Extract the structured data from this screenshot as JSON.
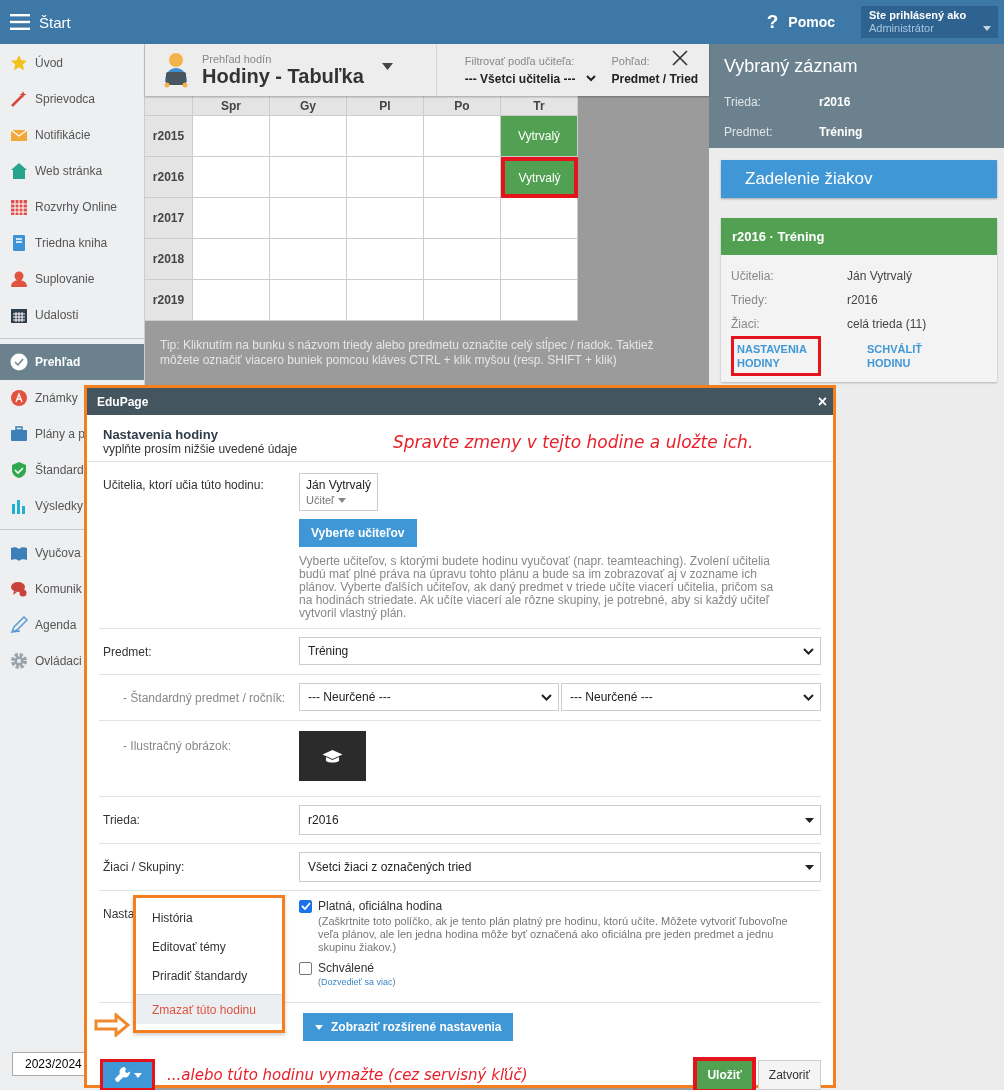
{
  "topbar": {
    "title": "Štart",
    "help_icon": "?",
    "help": "Pomoc",
    "user_label": "Ste prihlásený ako",
    "user_name": "Administrátor"
  },
  "sidebar": {
    "groups": [
      {
        "items": [
          {
            "label": "Úvod",
            "selected": false
          },
          {
            "label": "Sprievodca",
            "selected": false
          },
          {
            "label": "Notifikácie",
            "selected": false
          },
          {
            "label": "Web stránka",
            "selected": false
          },
          {
            "label": "Rozvrhy Online",
            "selected": false
          },
          {
            "label": "Triedna kniha",
            "selected": false
          },
          {
            "label": "Suplovanie",
            "selected": false
          },
          {
            "label": "Udalosti",
            "selected": false
          }
        ]
      },
      {
        "items": [
          {
            "label": "Prehľad",
            "selected": true
          },
          {
            "label": "Známky",
            "selected": false
          },
          {
            "label": "Plány a p",
            "selected": false
          },
          {
            "label": "Štandard",
            "selected": false
          },
          {
            "label": "Výsledky",
            "selected": false
          }
        ]
      },
      {
        "items": [
          {
            "label": "Vyučova",
            "selected": false
          },
          {
            "label": "Komunik",
            "selected": false
          },
          {
            "label": "Agenda",
            "selected": false
          },
          {
            "label": "Ovládaci",
            "selected": false
          }
        ]
      }
    ],
    "year": "2023/2024"
  },
  "header": {
    "subtitle": "Prehľad hodín",
    "title": "Hodiny - Tabuľka",
    "filter_label": "Filtrovať podľa učiteľa:",
    "filter_value": "--- Všetci učitelia ---",
    "view_label": "Pohľad:",
    "view_value": "Predmet / Tried"
  },
  "table": {
    "columns": [
      "Spr",
      "Gy",
      "Pl",
      "Po",
      "Tr"
    ],
    "rows": [
      {
        "name": "r2015",
        "cells": [
          null,
          null,
          null,
          null,
          {
            "text": "Vytrvalý",
            "marked": false
          }
        ]
      },
      {
        "name": "r2016",
        "cells": [
          null,
          null,
          null,
          null,
          {
            "text": "Vytrvalý",
            "marked": true
          }
        ]
      },
      {
        "name": "r2017",
        "cells": [
          null,
          null,
          null,
          null,
          null
        ]
      },
      {
        "name": "r2018",
        "cells": [
          null,
          null,
          null,
          null,
          null
        ]
      },
      {
        "name": "r2019",
        "cells": [
          null,
          null,
          null,
          null,
          null
        ]
      }
    ]
  },
  "tip": "Tip: Kliknutím na bunku s názvom triedy alebo predmetu označíte celý stĺpec / riadok. Taktiež môžete označiť viacero buniek pomcou kláves CTRL + klik myšou (resp. SHIFT + klik)",
  "selected_record": {
    "title": "Vybraný záznam",
    "fields": [
      {
        "label": "Trieda:",
        "value": "r2016"
      },
      {
        "label": "Predmet:",
        "value": "Tréning"
      }
    ],
    "button": "Zadelenie žiakov",
    "card": {
      "title": "r2016 · Tréning",
      "fields": [
        {
          "label": "Učitelia:",
          "value": "Ján Vytrvalý"
        },
        {
          "label": "Triedy:",
          "value": "r2016"
        },
        {
          "label": "Žiaci:",
          "value": "celá trieda (11)"
        }
      ],
      "links": [
        {
          "label": "NASTAVENIA HODINY",
          "marked": true
        },
        {
          "label": "SCHVÁLIŤ HODINU",
          "marked": false
        }
      ]
    }
  },
  "dialog": {
    "title": "EduPage",
    "close": "×",
    "heading": "Nastavenia hodiny",
    "subheading": "vyplňte prosím nižšie uvedené údaje",
    "teachers_label": "Učitelia, ktorí učia túto hodinu:",
    "teacher": {
      "name": "Ján Vytrvalý",
      "role": "Učiteľ"
    },
    "select_teachers_button": "Vyberte učiteľov",
    "teachers_help": "Vyberte učiteľov, s ktorými budete hodinu vyučovať (napr. teamteaching). Zvolení učitelia budú mať plné práva na úpravu tohto plánu a bude sa im zobrazovať aj v zozname ich plánov. Vyberte ďalších učiteľov, ak daný predmet v triede učíte viacerí učitelia, pričom sa na hodinách striedate. Ak učíte viacerí ale rôzne skupiny, je potrebné, aby si každý učiteľ vytvoril vlastný plán.",
    "fields": [
      {
        "kind": "select",
        "label": "Predmet:",
        "sub": false,
        "values": [
          "Tréning"
        ]
      },
      {
        "kind": "select",
        "label": "- Štandardný predmet / ročník:",
        "sub": true,
        "values": [
          "--- Neurčené ---",
          "--- Neurčené ---"
        ]
      },
      {
        "kind": "image",
        "label": "- Ilustračný obrázok:",
        "sub": true
      },
      {
        "kind": "dropdown",
        "label": "Trieda:",
        "sub": false,
        "values": [
          "r2016"
        ]
      },
      {
        "kind": "dropdown",
        "label": "Žiaci / Skupiny:",
        "sub": false,
        "values": [
          "Všetci žiaci z označených tried"
        ]
      }
    ],
    "settings": {
      "label": "Nasta",
      "options": [
        {
          "label": "Platná, oficiálna hodina",
          "checked": true,
          "help": "(Zaškrtnite toto políčko, ak je tento plán platný pre hodinu, ktorú učíte. Môžete vytvoriť ľubovoľne veľa plánov, ale len jedna hodina môže byť označená ako oficiálna pre jeden predmet a jednu skupinu žiakov.)"
        },
        {
          "label": "Schválené",
          "checked": false,
          "link_before": "(",
          "link": "Dozvedieť sa viac",
          "link_after": ")"
        }
      ]
    },
    "advanced_button": "Zobraziť rozšírené nastavenia",
    "menu": {
      "items": [
        {
          "label": "História",
          "kind": "normal",
          "selected": false
        },
        {
          "label": "Editovať témy",
          "kind": "normal",
          "selected": false
        },
        {
          "label": "Priradiť štandardy",
          "kind": "normal",
          "selected": false
        },
        {
          "label": "Zmazať túto hodinu",
          "kind": "danger",
          "selected": true
        }
      ]
    },
    "save": "Uložiť",
    "save_marked": true,
    "cancel": "Zatvoriť",
    "tools_marked": true
  },
  "annotations": [
    {
      "text": "Spravte zmeny v tejto hodine a uložte ich."
    },
    {
      "text": "...alebo túto hodinu vymažte (cez servisný kľúč)"
    }
  ]
}
